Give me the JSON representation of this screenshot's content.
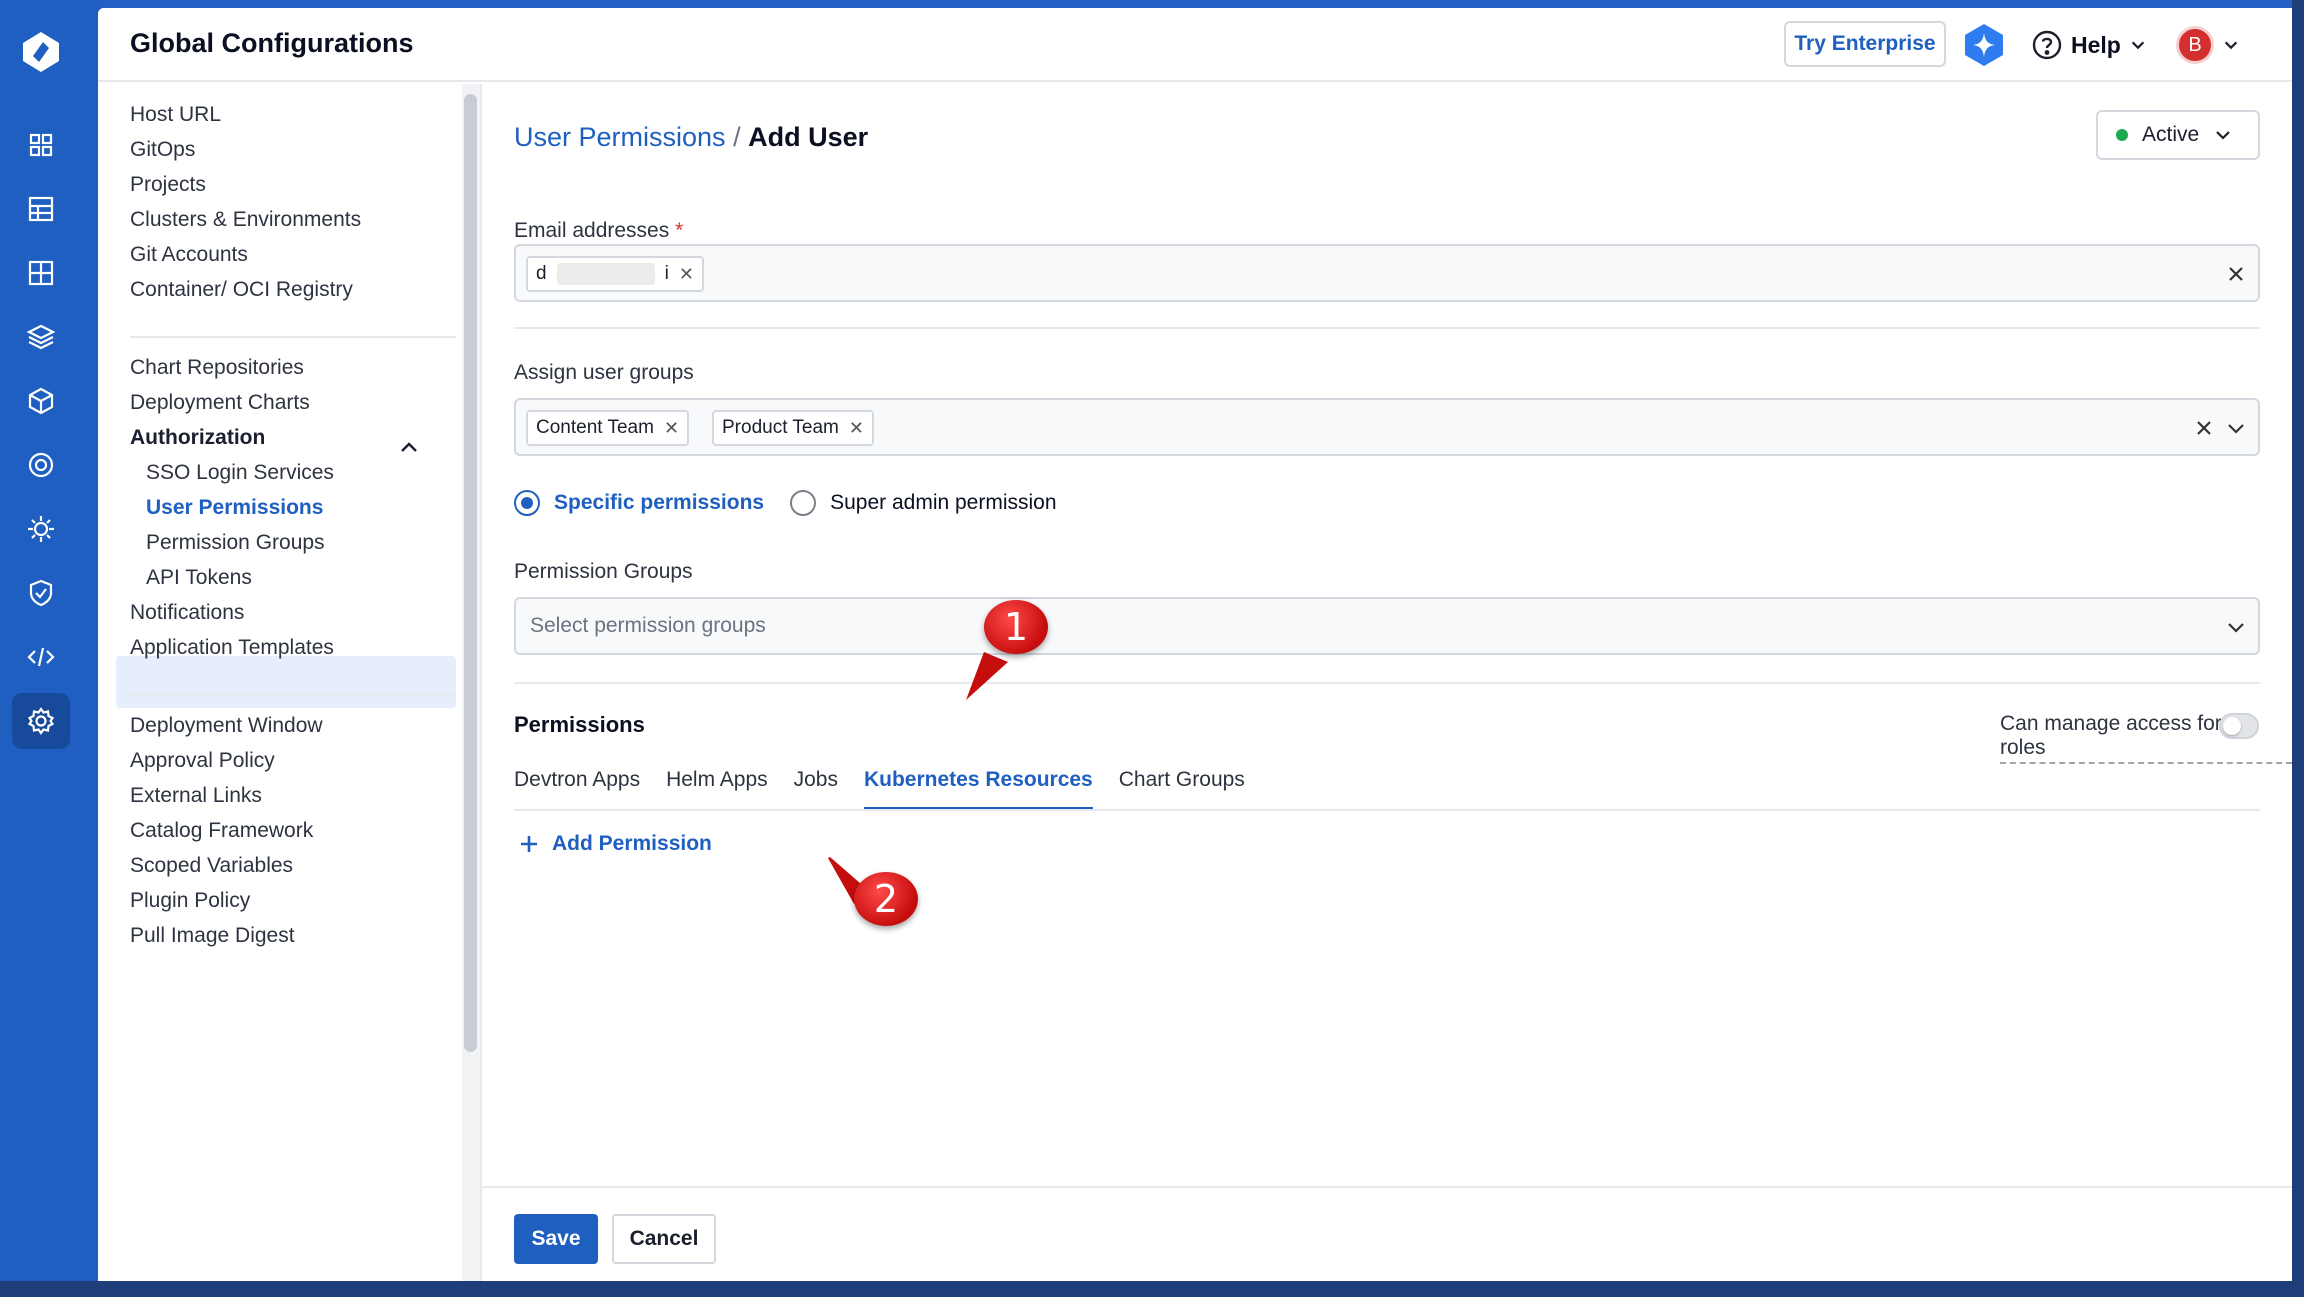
{
  "app": {
    "title": "Global Configurations",
    "try_enterprise": "Try Enterprise",
    "help": "Help",
    "avatar_initial": "B"
  },
  "rail_icons": [
    "logo-icon",
    "dashboard-icon",
    "applications-icon",
    "grid-icon",
    "stack-icon",
    "cube-icon",
    "security-scan-icon",
    "cluster-icon",
    "shield-icon",
    "code-icon",
    "settings-icon"
  ],
  "nav": {
    "items": [
      "Host URL",
      "GitOps",
      "Projects",
      "Clusters & Environments",
      "Git Accounts",
      "Container/ OCI Registry",
      "Chart Repositories",
      "Deployment Charts",
      "Authorization",
      "SSO Login Services",
      "User Permissions",
      "Permission Groups",
      "API Tokens",
      "Notifications",
      "Application Templates",
      "Deployment Window",
      "Approval Policy",
      "External Links",
      "Catalog Framework",
      "Scoped Variables",
      "Plugin Policy",
      "Pull Image Digest"
    ]
  },
  "breadcrumb": {
    "parent": "User Permissions",
    "sep": "/",
    "current": "Add User"
  },
  "status": "Active",
  "email": {
    "label": "Email addresses",
    "required": "*",
    "chip_start": "d",
    "chip_end": "i"
  },
  "groups": {
    "label": "Assign user groups",
    "chips": [
      "Content Team",
      "Product Team"
    ]
  },
  "permission_type": {
    "specific": "Specific permissions",
    "super_admin": "Super admin permission",
    "selected": "Specific permissions"
  },
  "permission_groups": {
    "label": "Permission Groups",
    "placeholder": "Select permission groups"
  },
  "permissions": {
    "title": "Permissions",
    "manage_access": "Can manage access for all roles",
    "tabs": [
      "Devtron Apps",
      "Helm Apps",
      "Jobs",
      "Kubernetes Resources",
      "Chart Groups"
    ],
    "active_tab": "Kubernetes Resources",
    "add": "Add Permission"
  },
  "footer": {
    "save": "Save",
    "cancel": "Cancel"
  },
  "callouts": [
    "1",
    "2"
  ],
  "colors": {
    "brand": "#1f5fc0",
    "callout": "#d71919",
    "status_green": "#1ea84f"
  }
}
